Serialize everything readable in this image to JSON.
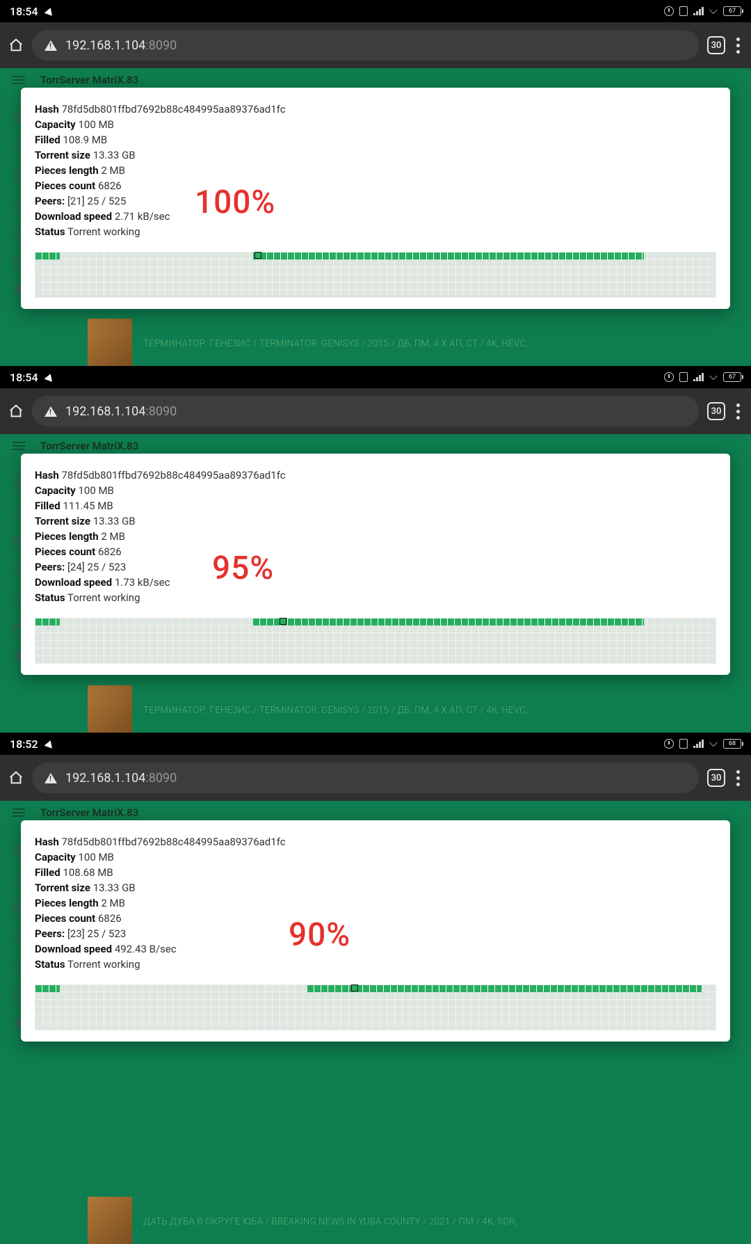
{
  "shots": [
    {
      "time": "18:54",
      "battery": "67",
      "url_host": "192.168.1.104",
      "url_port": ":8090",
      "tab_count": "30",
      "app_title": "TorrServer MatriX.83",
      "pct": "100%",
      "pct_left": 250,
      "stats": {
        "hash_label": "Hash",
        "hash": "78fd5db801ffbd7692b88c484995aa89376ad1fc",
        "capacity_label": "Capacity",
        "capacity": "100 MB",
        "filled_label": "Filled",
        "filled": "108.9 MB",
        "size_label": "Torrent size",
        "size": "13.33 GB",
        "plen_label": "Pieces length",
        "plen": "2 MB",
        "pcount_label": "Pieces count",
        "pcount": "6826",
        "peers_label": "Peers:",
        "peers": "[21] 25 / 525",
        "dl_label": "Download speed",
        "dl": "2.71 kB/sec",
        "status_label": "Status",
        "status": "Torrent working"
      },
      "track": {
        "pre_pct": 3.6,
        "fill_start_pct": 32,
        "fill_end_pct": 89.5,
        "marker_pct": 32.3
      },
      "bg_title": "ТЕРМИНАТОР: ГЕНЕЗИС / TERMINATOR: GENISYS / 2015 / ДБ, ПМ, 4 Х АП, СТ / 4K, HEVC,"
    },
    {
      "time": "18:54",
      "battery": "67",
      "url_host": "192.168.1.104",
      "url_port": ":8090",
      "tab_count": "30",
      "app_title": "TorrServer MatriX.83",
      "pct": "95%",
      "pct_left": 275,
      "stats": {
        "hash_label": "Hash",
        "hash": "78fd5db801ffbd7692b88c484995aa89376ad1fc",
        "capacity_label": "Capacity",
        "capacity": "100 MB",
        "filled_label": "Filled",
        "filled": "111.45 MB",
        "size_label": "Torrent size",
        "size": "13.33 GB",
        "plen_label": "Pieces length",
        "plen": "2 MB",
        "pcount_label": "Pieces count",
        "pcount": "6826",
        "peers_label": "Peers:",
        "peers": "[24] 25 / 523",
        "dl_label": "Download speed",
        "dl": "1.73 kB/sec",
        "status_label": "Status",
        "status": "Torrent working"
      },
      "track": {
        "pre_pct": 3.6,
        "fill_start_pct": 32,
        "fill_end_pct": 89.5,
        "marker_pct": 36
      },
      "bg_title": "ТЕРМИНАТОР: ГЕНЕЗИС / TERMINATOR: GENISYS / 2015 / ДБ, ПМ, 4 Х АП, СТ / 4K, HEVC,"
    },
    {
      "time": "18:52",
      "battery": "68",
      "url_host": "192.168.1.104",
      "url_port": ":8090",
      "tab_count": "30",
      "app_title": "TorrServer MatriX.83",
      "pct": "90%",
      "pct_left": 385,
      "stats": {
        "hash_label": "Hash",
        "hash": "78fd5db801ffbd7692b88c484995aa89376ad1fc",
        "capacity_label": "Capacity",
        "capacity": "100 MB",
        "filled_label": "Filled",
        "filled": "108.68 MB",
        "size_label": "Torrent size",
        "size": "13.33 GB",
        "plen_label": "Pieces length",
        "plen": "2 MB",
        "pcount_label": "Pieces count",
        "pcount": "6826",
        "peers_label": "Peers:",
        "peers": "[23] 25 / 523",
        "dl_label": "Download speed",
        "dl": "492.43 B/sec",
        "status_label": "Status",
        "status": "Torrent working"
      },
      "track": {
        "pre_pct": 3.6,
        "fill_start_pct": 40,
        "fill_end_pct": 98,
        "marker_pct": 46.5
      },
      "bg_title": "ДАТЬ ДУБА В ОКРУГЕ ЮБА / BREAKING NEWS IN YUBA COUNTY / 2021 / ПМ / 4K, SDR,"
    }
  ]
}
